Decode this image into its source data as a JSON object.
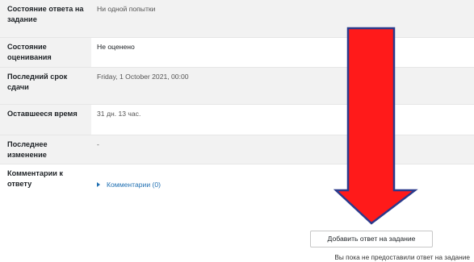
{
  "submission_status": {
    "rows": [
      {
        "label": "Состояние ответа на задание",
        "value": "Ни одной попытки"
      },
      {
        "label": "Состояние оценивания",
        "value": "Не оценено"
      },
      {
        "label": "Последний срок сдачи",
        "value": "Friday, 1 October 2021, 00:00"
      },
      {
        "label": "Оставшееся время",
        "value": "31 дн. 13 час."
      },
      {
        "label": "Последнее изменение",
        "value": "-"
      },
      {
        "label": "Комментарии к ответу",
        "value": "Комментарии (0)"
      }
    ]
  },
  "actions": {
    "add_submission_label": "Добавить ответ на задание",
    "note": "Вы пока не предоставили ответ на задание"
  },
  "colors": {
    "arrow_fill": "#ff1a1a",
    "arrow_outline": "#2b3a8c",
    "link": "#1f6fb2"
  },
  "icons": {
    "pointer_arrow": "red-down-arrow-icon",
    "comments_caret": "caret-right-icon"
  }
}
